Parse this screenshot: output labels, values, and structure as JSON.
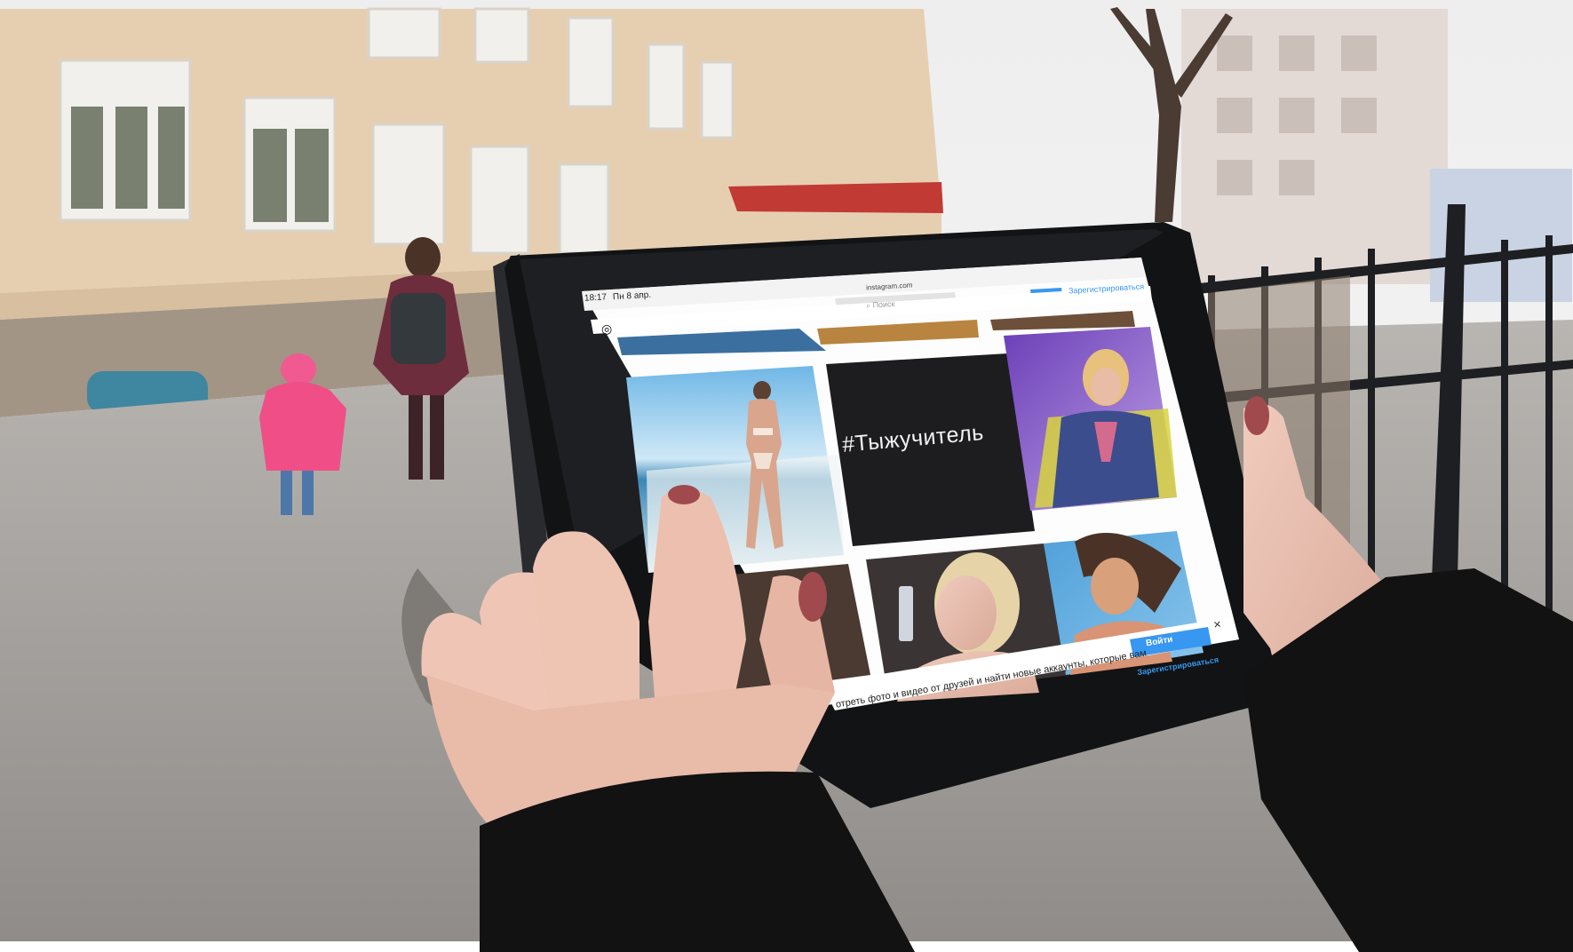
{
  "status_bar": {
    "time": "18:17",
    "date": "Пн 8 апр."
  },
  "browser": {
    "url": "instagram.com",
    "search_placeholder": "Поиск",
    "login_label": "Войти",
    "signup_label": "Зарегистрироваться"
  },
  "feed": {
    "hashtag_tile_text": "#Тыжучитель"
  },
  "signup_banner": {
    "login_label": "Войти",
    "signup_label": "Зарегистрироваться",
    "description": "отреть фото и видео от друзей и найти новые аккаунты, которые вам"
  },
  "colors": {
    "instagram_blue": "#3897f0",
    "sky": "#f2f2f2",
    "building_wall": "#e7d2b6",
    "asphalt": "#a8a8a8",
    "coat": "#121212",
    "skin": "#e9c0b2",
    "nail_polish": "#a04a4e"
  },
  "icons": {
    "instagram_logo": "instagram-icon",
    "search": "search-icon",
    "close": "close-icon",
    "video": "video-icon"
  }
}
